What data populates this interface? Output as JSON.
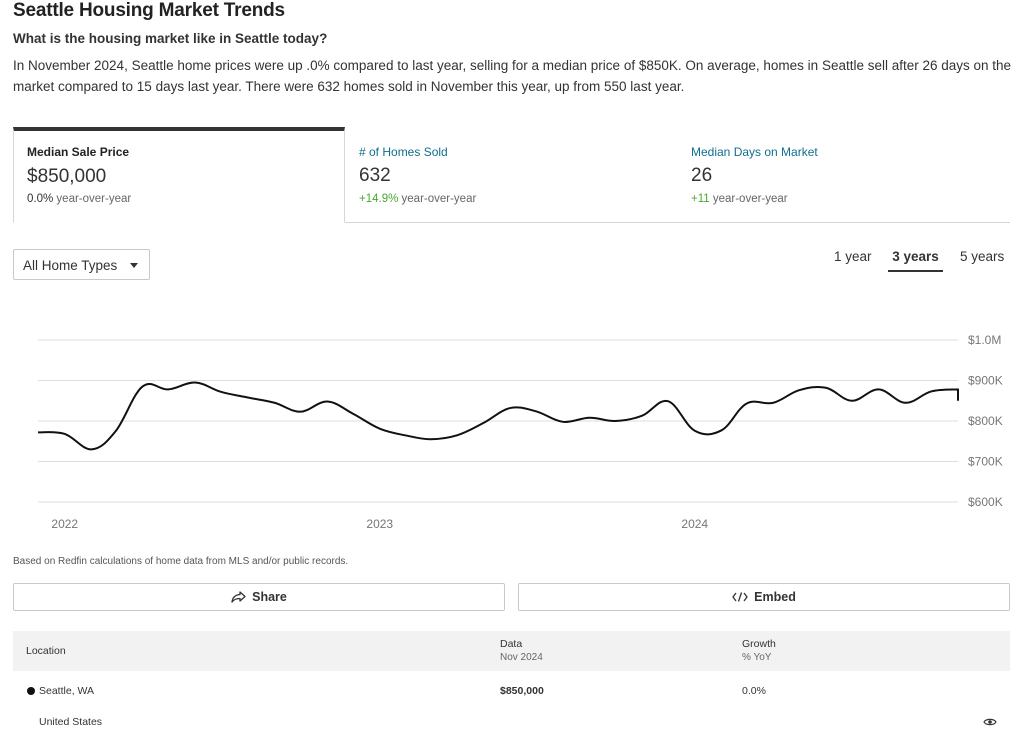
{
  "header": {
    "title": "Seattle Housing Market Trends",
    "subheading": "What is the housing market like in Seattle today?",
    "description": "In November 2024, Seattle home prices were up .0% compared to last year, selling for a median price of $850K. On average, homes in Seattle sell after 26 days on the market compared to 15 days last year. There were 632 homes sold in November this year, up from 550 last year."
  },
  "tabs": [
    {
      "label": "Median Sale Price",
      "value": "$850,000",
      "growth": "0.0%",
      "growth_suffix": "year-over-year",
      "active": true
    },
    {
      "label": "# of Homes Sold",
      "value": "632",
      "growth": "+14.9%",
      "growth_suffix": "year-over-year",
      "active": false
    },
    {
      "label": "Median Days on Market",
      "value": "26",
      "growth": "+11",
      "growth_suffix": "year-over-year",
      "active": false
    }
  ],
  "filter": {
    "selected": "All Home Types",
    "icon": "caret-down-icon"
  },
  "ranges": {
    "r1": "1 year",
    "r3": "3 years",
    "r5": "5 years",
    "selected": "3 years"
  },
  "chart_data": {
    "type": "line",
    "title": "",
    "xlabel": "",
    "ylabel": "",
    "x_ticks": [
      "2022",
      "2023",
      "2024"
    ],
    "y_ticks": [
      "$1.0M",
      "$900K",
      "$800K",
      "$700K",
      "$600K"
    ],
    "ylim": [
      600000,
      1000000
    ],
    "grid": true,
    "line_color": "#111111",
    "series": [
      {
        "name": "",
        "x": [
          "2021-12",
          "2022-01",
          "2022-02",
          "2022-03",
          "2022-04",
          "2022-05",
          "2022-06",
          "2022-07",
          "2022-08",
          "2022-09",
          "2022-10",
          "2022-11",
          "2022-12",
          "2023-01",
          "2023-02",
          "2023-03",
          "2023-04",
          "2023-05",
          "2023-06",
          "2023-07",
          "2023-08",
          "2023-09",
          "2023-10",
          "2023-11",
          "2023-12",
          "2024-01",
          "2024-02",
          "2024-03",
          "2024-04",
          "2024-05",
          "2024-06",
          "2024-07",
          "2024-08",
          "2024-09",
          "2024-10",
          "2024-11"
        ],
        "values": [
          772000,
          768000,
          730000,
          775000,
          885000,
          878000,
          895000,
          872000,
          858000,
          845000,
          823000,
          848000,
          818000,
          781000,
          764000,
          755000,
          765000,
          795000,
          832000,
          824000,
          798000,
          808000,
          800000,
          813000,
          849000,
          776000,
          777000,
          843000,
          845000,
          876000,
          882000,
          850000,
          878000,
          845000,
          873000,
          878000
        ]
      },
      {
        "name": "",
        "x": [
          "2024-11"
        ],
        "values": [
          850000
        ]
      }
    ]
  },
  "footnote": "Based on Redfin calculations of home data from MLS and/or public records.",
  "buttons": {
    "share": "Share",
    "share_icon": "share-icon",
    "embed": "Embed",
    "embed_icon": "code-icon"
  },
  "table": {
    "col_location": "Location",
    "col_data": "Data",
    "col_data_sub": "Nov 2024",
    "col_growth": "Growth",
    "col_growth_sub": "% YoY",
    "rows": [
      {
        "location": "Seattle, WA",
        "data": "$850,000",
        "growth": "0.0%"
      },
      {
        "location": "United States",
        "data": "",
        "growth": ""
      }
    ],
    "row2_icon": "eye-icon"
  }
}
